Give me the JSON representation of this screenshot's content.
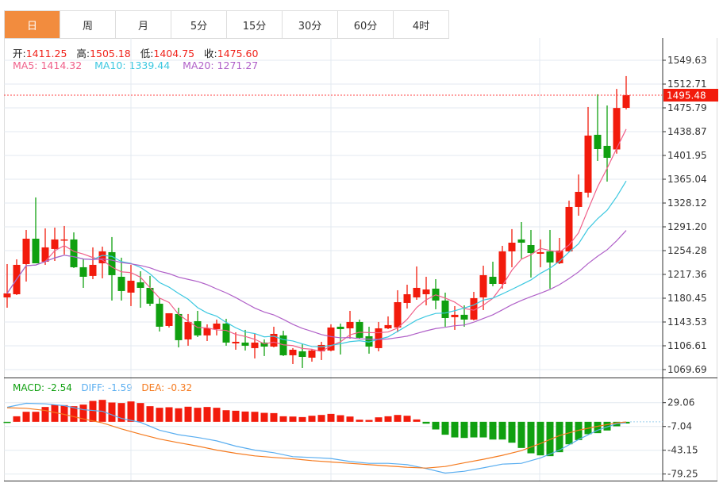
{
  "tabs": [
    {
      "label": "日",
      "active": true
    },
    {
      "label": "周"
    },
    {
      "label": "月"
    },
    {
      "label": "5分"
    },
    {
      "label": "15分"
    },
    {
      "label": "30分"
    },
    {
      "label": "60分"
    },
    {
      "label": "4时"
    }
  ],
  "ohlc_info": {
    "open_label": "开:",
    "open": "1411.25",
    "high_label": "高:",
    "high": "1505.18",
    "low_label": "低:",
    "low": "1404.75",
    "close_label": "收:",
    "close": "1475.60"
  },
  "ma_info": {
    "ma5": "MA5: 1414.32",
    "ma10": "MA10: 1339.44",
    "ma20": "MA20: 1271.27"
  },
  "macd_info": {
    "macd": "MACD: -2.54",
    "diff": "DIFF: -1.59",
    "dea": "DEA: -0.32"
  },
  "last_price": "1495.48",
  "colors": {
    "up": "#f21b0c",
    "down": "#10a010",
    "ma5": "#f0608a",
    "ma10": "#3cc8e0",
    "ma20": "#b060c8",
    "diff": "#5aaef0",
    "dea": "#f57a1e",
    "tab_active": "#f28c3e"
  },
  "chart_data": {
    "type": "candlestick",
    "price_axis": {
      "ticks": [
        "1549.63",
        "1512.71",
        "1475.79",
        "1438.87",
        "1401.95",
        "1365.04",
        "1328.12",
        "1291.20",
        "1254.28",
        "1217.36",
        "1180.45",
        "1143.53",
        "1106.61",
        "1069.69"
      ],
      "range": [
        1069.69,
        1549.63
      ]
    },
    "candles_ohlc": [
      [
        1181.7,
        1233.4,
        1165.7,
        1187.9
      ],
      [
        1186.6,
        1240.8,
        1185.4,
        1232.2
      ],
      [
        1233.4,
        1286.3,
        1206.3,
        1272.8
      ],
      [
        1272.8,
        1336.8,
        1234.6,
        1234.6
      ],
      [
        1237.1,
        1288.8,
        1232.2,
        1259.3
      ],
      [
        1256.8,
        1290.0,
        1238.3,
        1271.6
      ],
      [
        1270.3,
        1292.5,
        1248.2,
        1271.6
      ],
      [
        1271.6,
        1282.6,
        1227.3,
        1228.5
      ],
      [
        1228.5,
        1240.8,
        1196.5,
        1213.7
      ],
      [
        1215.0,
        1259.3,
        1210.0,
        1232.2
      ],
      [
        1234.6,
        1260.5,
        1211.3,
        1253.1
      ],
      [
        1251.9,
        1275.3,
        1176.8,
        1216.2
      ],
      [
        1213.7,
        1243.3,
        1176.8,
        1191.6
      ],
      [
        1189.1,
        1232.2,
        1168.2,
        1207.6
      ],
      [
        1205.1,
        1222.3,
        1165.7,
        1196.5
      ],
      [
        1196.5,
        1215.0,
        1168.2,
        1171.9
      ],
      [
        1171.9,
        1180.5,
        1128.8,
        1136.2
      ],
      [
        1137.4,
        1157.1,
        1135.0,
        1157.1
      ],
      [
        1155.9,
        1165.7,
        1104.2,
        1115.3
      ],
      [
        1116.5,
        1155.9,
        1106.7,
        1143.6
      ],
      [
        1144.8,
        1160.8,
        1120.2,
        1122.7
      ],
      [
        1122.7,
        1139.9,
        1114.0,
        1133.7
      ],
      [
        1132.5,
        1147.3,
        1122.7,
        1141.1
      ],
      [
        1141.1,
        1148.5,
        1106.7,
        1111.6
      ],
      [
        1110.3,
        1127.6,
        1100.5,
        1112.8
      ],
      [
        1111.6,
        1131.3,
        1099.3,
        1106.7
      ],
      [
        1103.0,
        1125.1,
        1087.0,
        1111.6
      ],
      [
        1111.6,
        1116.5,
        1090.7,
        1105.4
      ],
      [
        1105.4,
        1136.2,
        1104.2,
        1125.1
      ],
      [
        1122.7,
        1130.0,
        1090.7,
        1091.9
      ],
      [
        1091.9,
        1103.0,
        1078.3,
        1100.5
      ],
      [
        1098.0,
        1109.1,
        1072.2,
        1089.4
      ],
      [
        1088.2,
        1101.7,
        1082.0,
        1099.3
      ],
      [
        1098.0,
        1112.8,
        1084.5,
        1107.9
      ],
      [
        1099.3,
        1139.9,
        1098.0,
        1135.0
      ],
      [
        1136.2,
        1141.1,
        1093.1,
        1132.5
      ],
      [
        1133.7,
        1160.8,
        1117.7,
        1143.6
      ],
      [
        1143.6,
        1147.3,
        1117.7,
        1119.0
      ],
      [
        1121.4,
        1136.2,
        1094.4,
        1105.4
      ],
      [
        1103.0,
        1143.6,
        1098.0,
        1133.7
      ],
      [
        1133.7,
        1152.2,
        1132.5,
        1138.7
      ],
      [
        1135.0,
        1192.8,
        1127.6,
        1174.3
      ],
      [
        1173.1,
        1201.4,
        1164.5,
        1186.6
      ],
      [
        1181.7,
        1229.7,
        1178.0,
        1196.5
      ],
      [
        1186.6,
        1213.7,
        1169.4,
        1194.0
      ],
      [
        1195.3,
        1210.0,
        1163.3,
        1176.8
      ],
      [
        1176.8,
        1189.1,
        1136.2,
        1149.7
      ],
      [
        1151.0,
        1168.2,
        1131.3,
        1154.7
      ],
      [
        1154.7,
        1169.4,
        1136.2,
        1147.3
      ],
      [
        1147.3,
        1190.3,
        1146.0,
        1180.5
      ],
      [
        1181.7,
        1230.9,
        1162.0,
        1216.2
      ],
      [
        1213.7,
        1237.1,
        1199.0,
        1202.6
      ],
      [
        1202.6,
        1261.7,
        1195.3,
        1253.1
      ],
      [
        1253.1,
        1287.6,
        1228.5,
        1266.6
      ],
      [
        1271.6,
        1298.6,
        1242.0,
        1266.6
      ],
      [
        1262.9,
        1286.3,
        1212.5,
        1250.6
      ],
      [
        1249.4,
        1271.6,
        1228.5,
        1251.9
      ],
      [
        1253.1,
        1286.3,
        1195.3,
        1235.9
      ],
      [
        1234.6,
        1274.0,
        1233.4,
        1254.3
      ],
      [
        1253.1,
        1331.9,
        1251.9,
        1322.0
      ],
      [
        1322.0,
        1372.5,
        1308.5,
        1345.4
      ],
      [
        1344.2,
        1477.1,
        1336.8,
        1432.8
      ],
      [
        1434.0,
        1496.8,
        1393.4,
        1411.8
      ],
      [
        1416.8,
        1479.5,
        1361.4,
        1398.3
      ],
      [
        1411.25,
        1505.18,
        1404.75,
        1475.6
      ],
      [
        1475.8,
        1525.1,
        1473.4,
        1495.48
      ]
    ],
    "moving_averages": [
      "MA5",
      "MA10",
      "MA20"
    ],
    "macd": {
      "axis_ticks": [
        "29.06",
        "-7.04",
        "-43.15",
        "-79.25"
      ],
      "range": [
        -79.25,
        29.06
      ],
      "histogram": [
        -1.2,
        8.4,
        15.2,
        15.2,
        22.5,
        25.7,
        25.3,
        23.7,
        26.1,
        31.7,
        33.3,
        29.3,
        28.5,
        30.9,
        28.5,
        23.7,
        21.3,
        22.1,
        20.5,
        22.9,
        21.3,
        22.5,
        21.3,
        17.6,
        16.8,
        15.6,
        15.2,
        13.6,
        13.2,
        8.4,
        8.0,
        7.2,
        9.2,
        10.4,
        12.0,
        10.0,
        8.0,
        3.2,
        2.8,
        6.8,
        8.4,
        10.4,
        9.2,
        3.6,
        -2.8,
        -11.6,
        -19.6,
        -23.7,
        -24.5,
        -23.7,
        -23.7,
        -26.9,
        -26.9,
        -31.7,
        -39.7,
        -47.8,
        -50.9,
        -52.1,
        -46.1,
        -34.1,
        -27.7,
        -18.8,
        -17.2,
        -13.2,
        -6.8,
        -2.54
      ],
      "diff_points": [
        [
          1,
          22.1
        ],
        [
          3,
          28.1
        ],
        [
          5,
          27.3
        ],
        [
          7,
          24.5
        ],
        [
          9,
          18.4
        ],
        [
          11,
          16.0
        ],
        [
          13,
          5.2
        ],
        [
          15,
          -0.8
        ],
        [
          17,
          -12.8
        ],
        [
          19,
          -19.6
        ],
        [
          21,
          -23.7
        ],
        [
          23,
          -28.9
        ],
        [
          25,
          -36.9
        ],
        [
          27,
          -42.9
        ],
        [
          29,
          -46.9
        ],
        [
          31,
          -52.9
        ],
        [
          33,
          -54.1
        ],
        [
          35,
          -55.7
        ],
        [
          37,
          -60.2
        ],
        [
          39,
          -63.0
        ],
        [
          41,
          -63.0
        ],
        [
          43,
          -65.0
        ],
        [
          45,
          -71.0
        ],
        [
          47,
          -77.8
        ],
        [
          49,
          -75.0
        ],
        [
          51,
          -69.8
        ],
        [
          53,
          -64.2
        ],
        [
          55,
          -63.0
        ],
        [
          57,
          -54.9
        ],
        [
          59,
          -42.9
        ],
        [
          61,
          -26.9
        ],
        [
          63,
          -12.8
        ],
        [
          65,
          -2.8
        ],
        [
          66,
          -1.59
        ]
      ],
      "dea_points": [
        [
          1,
          21.3
        ],
        [
          3,
          20.5
        ],
        [
          5,
          17.2
        ],
        [
          7,
          11.2
        ],
        [
          9,
          4.4
        ],
        [
          11,
          -1.6
        ],
        [
          13,
          -10.8
        ],
        [
          15,
          -18.8
        ],
        [
          17,
          -26.1
        ],
        [
          19,
          -31.7
        ],
        [
          21,
          -36.9
        ],
        [
          23,
          -42.9
        ],
        [
          25,
          -47.7
        ],
        [
          27,
          -51.7
        ],
        [
          29,
          -54.1
        ],
        [
          31,
          -56.1
        ],
        [
          33,
          -58.9
        ],
        [
          35,
          -61.0
        ],
        [
          37,
          -63.0
        ],
        [
          39,
          -65.0
        ],
        [
          41,
          -67.0
        ],
        [
          43,
          -69.0
        ],
        [
          45,
          -70.2
        ],
        [
          47,
          -67.8
        ],
        [
          49,
          -62.2
        ],
        [
          51,
          -56.9
        ],
        [
          53,
          -50.9
        ],
        [
          55,
          -43.7
        ],
        [
          57,
          -32.9
        ],
        [
          59,
          -20.9
        ],
        [
          61,
          -12.8
        ],
        [
          63,
          -6.8
        ],
        [
          65,
          -1.6
        ],
        [
          66,
          -0.32
        ]
      ]
    },
    "grid": true
  }
}
